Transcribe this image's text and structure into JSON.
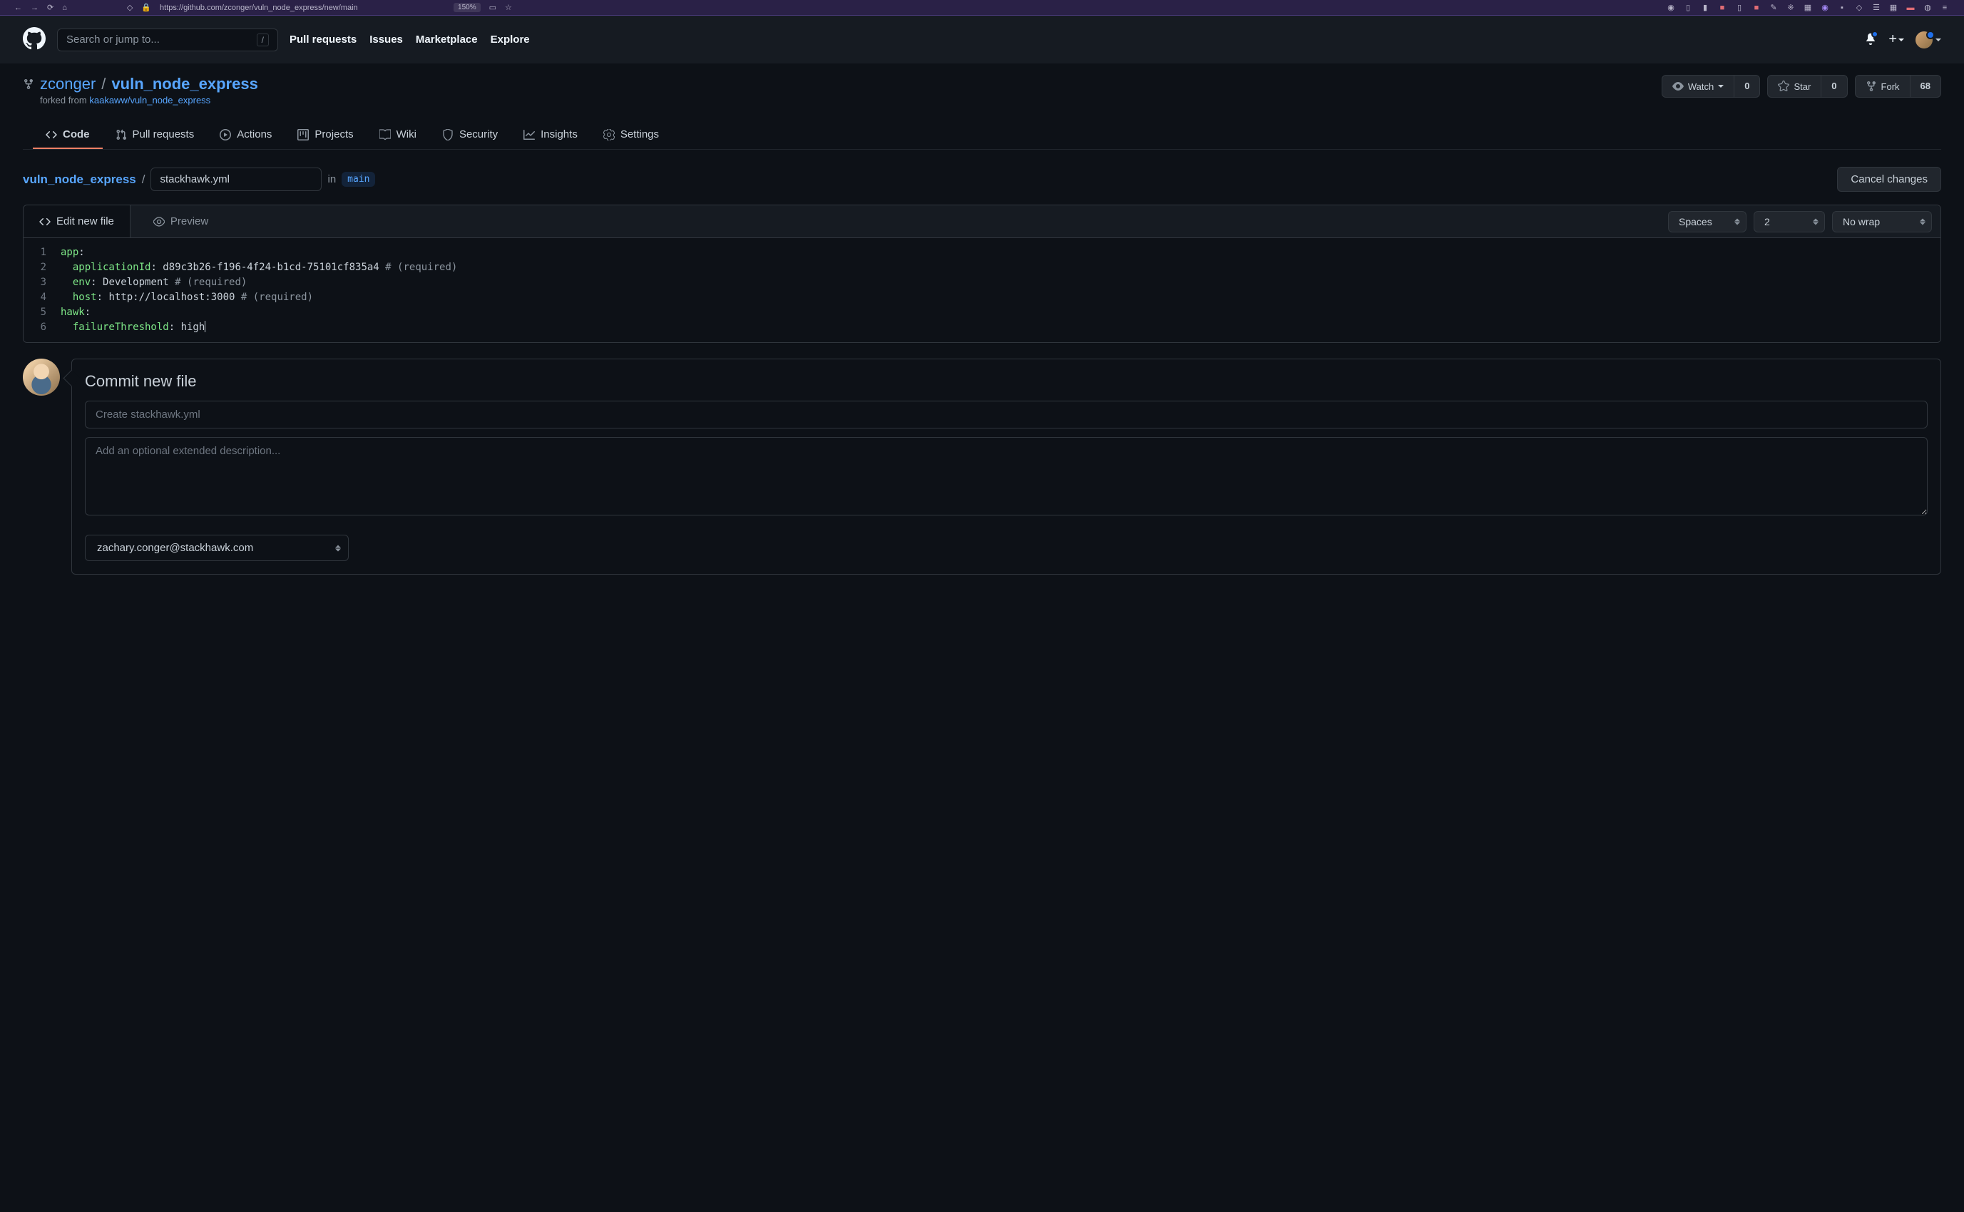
{
  "browser": {
    "url": "https://github.com/zconger/vuln_node_express/new/main",
    "zoom": "150%"
  },
  "header": {
    "search_placeholder": "Search or jump to...",
    "slash": "/",
    "nav": {
      "pull_requests": "Pull requests",
      "issues": "Issues",
      "marketplace": "Marketplace",
      "explore": "Explore"
    }
  },
  "repo": {
    "owner": "zconger",
    "name": "vuln_node_express",
    "forked_prefix": "forked from ",
    "forked_source": "kaakaww/vuln_node_express",
    "actions": {
      "watch": {
        "label": "Watch",
        "count": "0"
      },
      "star": {
        "label": "Star",
        "count": "0"
      },
      "fork": {
        "label": "Fork",
        "count": "68"
      }
    },
    "tabs": {
      "code": "Code",
      "pull_requests": "Pull requests",
      "actions": "Actions",
      "projects": "Projects",
      "wiki": "Wiki",
      "security": "Security",
      "insights": "Insights",
      "settings": "Settings"
    }
  },
  "breadcrumb": {
    "repo_link": "vuln_node_express",
    "sep": "/",
    "filename": "stackhawk.yml",
    "in": "in",
    "branch": "main",
    "cancel": "Cancel changes"
  },
  "editor": {
    "tabs": {
      "edit": "Edit new file",
      "preview": "Preview"
    },
    "controls": {
      "indent_mode": "Spaces",
      "indent_size": "2",
      "wrap_mode": "No wrap"
    },
    "lines": [
      {
        "n": "1",
        "key": "app",
        "colon": ":",
        "val": "",
        "comment": ""
      },
      {
        "n": "2",
        "indent": "  ",
        "key": "applicationId",
        "colon": ": ",
        "val": "d89c3b26-f196-4f24-b1cd-75101cf835a4 ",
        "comment": "# (required)"
      },
      {
        "n": "3",
        "indent": "  ",
        "key": "env",
        "colon": ": ",
        "val": "Development ",
        "comment": "# (required)"
      },
      {
        "n": "4",
        "indent": "  ",
        "key": "host",
        "colon": ": ",
        "val": "http://localhost:3000 ",
        "comment": "# (required)"
      },
      {
        "n": "5",
        "key": "hawk",
        "colon": ":",
        "val": "",
        "comment": ""
      },
      {
        "n": "6",
        "indent": "  ",
        "key": "failureThreshold",
        "colon": ": ",
        "val": "high",
        "comment": "",
        "cursor": true
      }
    ]
  },
  "commit": {
    "title": "Commit new file",
    "summary_placeholder": "Create stackhawk.yml",
    "description_placeholder": "Add an optional extended description...",
    "email": "zachary.conger@stackhawk.com"
  }
}
